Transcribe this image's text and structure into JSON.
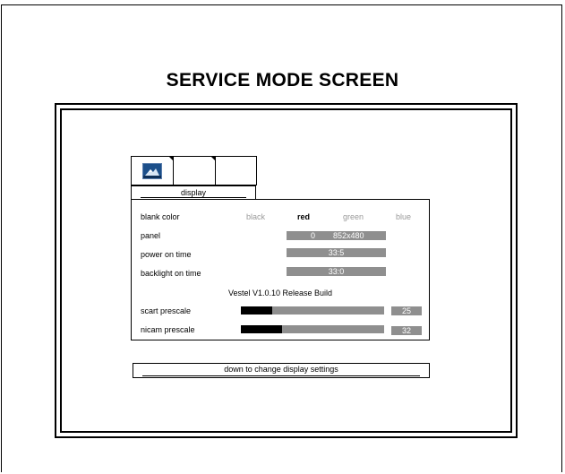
{
  "title": "SERVICE MODE SCREEN",
  "tabs": [
    {
      "icon": "display-settings-icon"
    },
    {
      "icon": ""
    },
    {
      "icon": ""
    }
  ],
  "section_label": "display",
  "blank_color": {
    "label": "blank color",
    "options": [
      "black",
      "red",
      "green",
      "blue"
    ],
    "selected": "red"
  },
  "panel": {
    "label": "panel",
    "index": "0",
    "resolution": "852x480"
  },
  "power_on_time": {
    "label": "power on time",
    "value": "33:5"
  },
  "backlight_on_time": {
    "label": "backlight on time",
    "value": "33:0"
  },
  "version": "Vestel V1.0.10 Release Build",
  "scart_prescale": {
    "label": "scart prescale",
    "value": "25",
    "fill_fraction": 0.22
  },
  "nicam_prescale": {
    "label": "nicam prescale",
    "value": "32",
    "fill_fraction": 0.29
  },
  "hint": "down to change display settings",
  "colors": {
    "bar_gray": "#8f8f8f",
    "selected_text": "#000000",
    "unselected_text": "#9a9a9a"
  }
}
